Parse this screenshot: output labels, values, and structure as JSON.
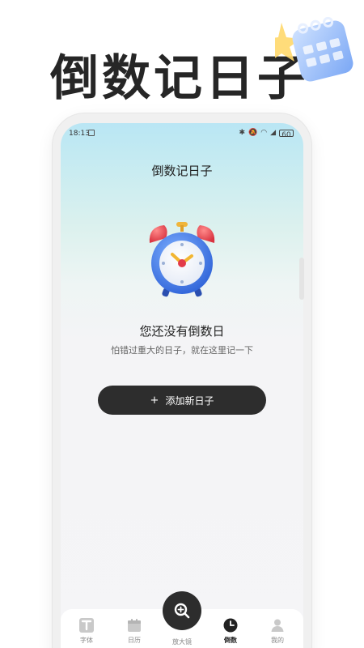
{
  "promo": {
    "title": "倒数记日子"
  },
  "status_bar": {
    "time": "18:13",
    "battery": "60"
  },
  "screen": {
    "title": "倒数记日子",
    "empty_title": "您还没有倒数日",
    "empty_subtitle": "怕错过重大的日子，就在这里记一下"
  },
  "add_button": {
    "icon": "+",
    "label": "添加新日子"
  },
  "nav": {
    "items": [
      {
        "label": "字体",
        "icon": "font-icon",
        "active": false
      },
      {
        "label": "日历",
        "icon": "calendar-icon",
        "active": false
      },
      {
        "label": "放大镜",
        "icon": "magnifier-icon",
        "active": false
      },
      {
        "label": "倒数",
        "icon": "clock-icon",
        "active": true
      },
      {
        "label": "我的",
        "icon": "user-icon",
        "active": false
      }
    ]
  },
  "colors": {
    "accent_dark": "#2d2d2d",
    "screen_gradient_top": "#b9e6f4",
    "background": "#f5f5f7"
  }
}
